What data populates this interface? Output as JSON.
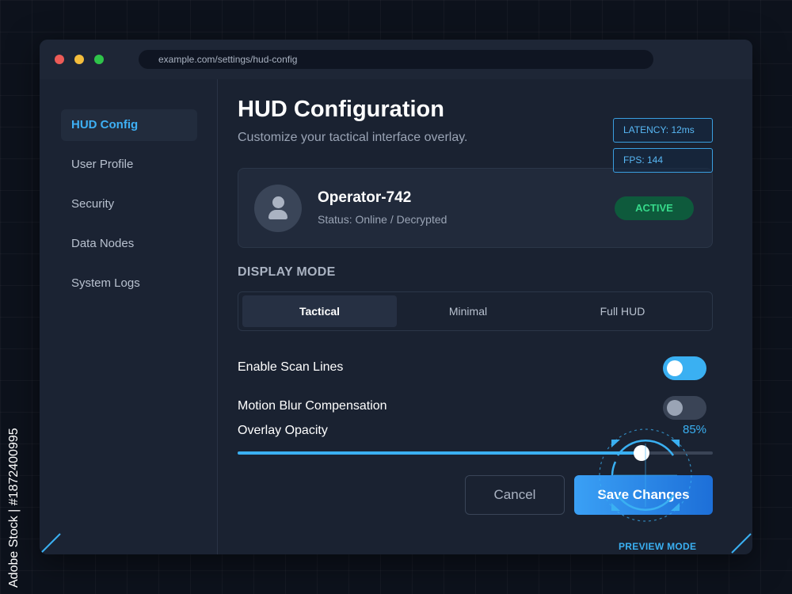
{
  "window": {
    "url": "example.com/settings/hud-config"
  },
  "sidebar": {
    "items": [
      {
        "label": "HUD Config",
        "active": true
      },
      {
        "label": "User Profile",
        "active": false
      },
      {
        "label": "Security",
        "active": false
      },
      {
        "label": "Data Nodes",
        "active": false
      },
      {
        "label": "System Logs",
        "active": false
      }
    ]
  },
  "header": {
    "title": "HUD Configuration",
    "subtitle": "Customize your tactical interface overlay."
  },
  "hud_stats": {
    "latency": "LATENCY: 12ms",
    "fps": "FPS: 144"
  },
  "profile": {
    "name": "Operator-742",
    "status": "Status: Online / Decrypted",
    "badge": "ACTIVE"
  },
  "display_mode": {
    "label": "DISPLAY MODE",
    "options": [
      "Tactical",
      "Minimal",
      "Full HUD"
    ],
    "selected": "Tactical"
  },
  "settings": {
    "scan_lines": {
      "label": "Enable Scan Lines",
      "enabled": true
    },
    "motion_blur": {
      "label": "Motion Blur Compensation",
      "enabled": false
    },
    "opacity": {
      "label": "Overlay Opacity",
      "value_text": "85%",
      "value": 0.85
    }
  },
  "actions": {
    "cancel": "Cancel",
    "save": "Save Changes"
  },
  "preview": {
    "label": "PREVIEW MODE"
  },
  "watermark": {
    "text": "Adobe Stock | #1872400995"
  },
  "colors": {
    "accent": "#3ab0f2",
    "active_green": "#36d98a",
    "background": "#0d121c",
    "panel": "#1a2231"
  },
  "icons": [
    "user-avatar-icon",
    "crosshair-reticle-icon"
  ]
}
